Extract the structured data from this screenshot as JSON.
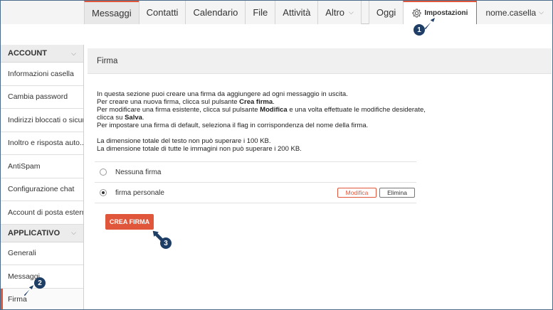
{
  "nav": {
    "items": [
      {
        "label": "Messaggi",
        "active": true
      },
      {
        "label": "Contatti"
      },
      {
        "label": "Calendario"
      },
      {
        "label": "File"
      },
      {
        "label": "Attività"
      },
      {
        "label": "Altro",
        "dropdown": true
      }
    ],
    "today": "Oggi",
    "settings": "Impostazioni",
    "user": "nome.casella"
  },
  "sidebar": {
    "account_header": "ACCOUNT",
    "account_items": [
      "Informazioni casella",
      "Cambia password",
      "Indirizzi bloccati o sicuri",
      "Inoltro e risposta auto...",
      "AntiSpam",
      "Configurazione chat",
      "Account di posta esterni"
    ],
    "app_header": "APPLICATIVO",
    "app_items": [
      "Generali",
      "Messaggi",
      "Firma"
    ]
  },
  "panel": {
    "title": "Firma",
    "desc": {
      "line1": "In questa sezione puoi creare una firma da aggiungere ad ogni messaggio in uscita.",
      "line2_pre": "Per creare una nuova firma, clicca sul pulsante ",
      "line2_bold": "Crea firma",
      "line2_post": ".",
      "line3_pre": "Per modificare una firma esistente, clicca sul pulsante ",
      "line3_bold": "Modifica",
      "line3_post": " e una volta effettuate le modifiche desiderate,",
      "line4_pre": "clicca su ",
      "line4_bold": "Salva",
      "line4_post": ".",
      "line5": "Per impostare una firma di default, seleziona il flag in corrispondenza del nome della firma.",
      "line6": "La dimensione totale del testo non può superare i 100 KB.",
      "line7": "La dimensione totale di tutte le immagini non può superare i 200 KB."
    },
    "options": [
      {
        "label": "Nessuna firma",
        "checked": false
      },
      {
        "label": "firma personale",
        "checked": true,
        "edit": "Modifica",
        "delete": "Elimina"
      }
    ],
    "create_button": "CREA FIRMA"
  },
  "callouts": [
    "1",
    "2",
    "3"
  ],
  "colors": {
    "accent": "#e0563a",
    "callout": "#1f3e66"
  },
  "icons": {
    "settings": "gear-icon",
    "dropdown": "chevron-down-icon",
    "pointer": "arrow-pointer-icon"
  }
}
